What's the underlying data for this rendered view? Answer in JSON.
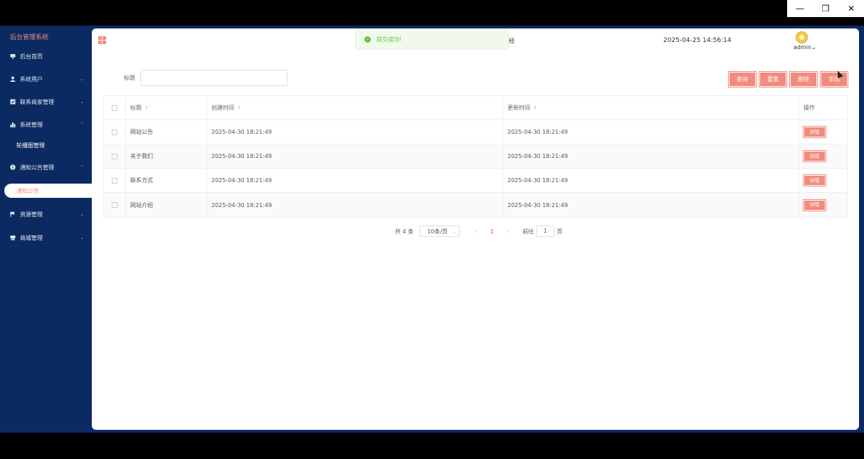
{
  "window": {
    "controls": [
      "—",
      "❐",
      "✕"
    ]
  },
  "sidebar": {
    "brand": "后台管理系统",
    "items": [
      {
        "label": "后台首页",
        "icon": "monitor-icon",
        "arrow": ""
      },
      {
        "label": "系统用户",
        "icon": "user-icon",
        "arrow": "⌄"
      },
      {
        "label": "联系商家管理",
        "icon": "checkbox-icon",
        "arrow": "⌄"
      },
      {
        "label": "系统管理",
        "icon": "bar-chart-icon",
        "arrow": "⌃"
      },
      {
        "label": "通知公告管理",
        "icon": "info-icon",
        "arrow": "⌃"
      },
      {
        "label": "资源管理",
        "icon": "flag-icon",
        "arrow": "⌄"
      },
      {
        "label": "商城管理",
        "icon": "store-icon",
        "arrow": "⌄"
      }
    ],
    "sub_items": {
      "system": "轮播图管理",
      "notice_active": "通知公告"
    }
  },
  "header": {
    "partial_char": "经",
    "datetime": "2025-04-25 14:56:14",
    "username": "admin",
    "username_arrow": "⌄"
  },
  "toast": {
    "text": "提交成功!"
  },
  "filter": {
    "label": "标题",
    "value": "",
    "placeholder": ""
  },
  "actions": {
    "query": "查询",
    "reset": "重置",
    "delete": "删除",
    "add": "添加"
  },
  "table": {
    "headers": {
      "title": "标题",
      "created": "创建时间",
      "updated": "更新时间",
      "ops": "操作"
    },
    "sort_glyph": "⇕",
    "detail_label": "详情",
    "rows": [
      {
        "title": "网站公告",
        "created": "2025-04-30 18:21:49",
        "updated": "2025-04-30 18:21:49"
      },
      {
        "title": "关于我们",
        "created": "2025-04-30 18:21:49",
        "updated": "2025-04-30 18:21:49"
      },
      {
        "title": "联系方式",
        "created": "2025-04-30 18:21:49",
        "updated": "2025-04-30 18:21:49"
      },
      {
        "title": "网站介绍",
        "created": "2025-04-30 18:21:49",
        "updated": "2025-04-30 18:21:49"
      }
    ]
  },
  "pagination": {
    "total": "共 4 条",
    "page_size": "10条/页",
    "prev": "‹",
    "current": "1",
    "next": "›",
    "goto_label": "前往",
    "goto_value": "1",
    "page_unit": "页"
  },
  "colors": {
    "sidebar_bg": "#0b2a62",
    "accent": "#f28b7d",
    "success": "#67c23a"
  }
}
